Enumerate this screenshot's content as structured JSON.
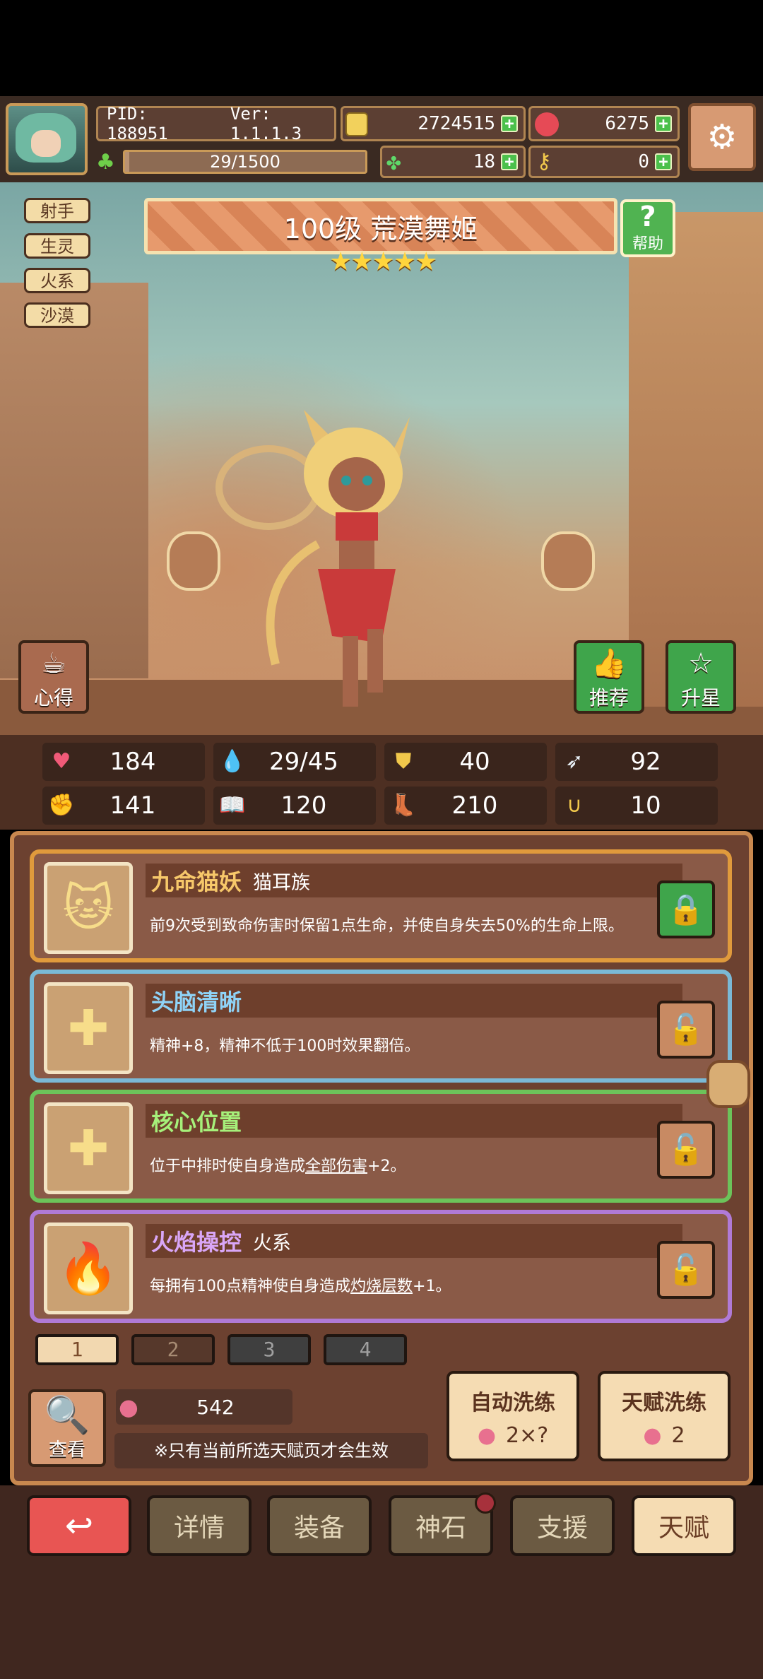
{
  "header": {
    "pid": "PID: 188951",
    "version": "Ver: 1.1.1.3",
    "exp": "29/1500",
    "exp_fraction": 0.019,
    "gold": "2724515",
    "gems": "6275",
    "clover": "18",
    "key": "0"
  },
  "tags": [
    "射手",
    "生灵",
    "火系",
    "沙漠"
  ],
  "hero": {
    "title": "100级  荒漠舞姬",
    "stars": "★★★★★",
    "star_count": 5
  },
  "buttons": {
    "help": "帮助",
    "notes": "心得",
    "recommend": "推荐",
    "star_up": "升星"
  },
  "stats": [
    "184",
    "29/45",
    "40",
    "92",
    "141",
    "120",
    "210",
    "10"
  ],
  "talents": [
    {
      "name": "九命猫妖",
      "sub": "猫耳族",
      "desc": "前9次受到致命伤害时保留1点生命，并使自身失去50%的生命上限。",
      "name_color": "#f7c86a",
      "border": "#e09a3c",
      "locked": true
    },
    {
      "name": "头脑清晰",
      "sub": "",
      "desc": "精神+8，精神不低于100时效果翻倍。",
      "name_color": "#8fd3f7",
      "border": "#7ab9d6",
      "locked": false
    },
    {
      "name": "核心位置",
      "sub": "",
      "desc_pre": "位于中排时使自身造成",
      "desc_u": "全部伤害",
      "desc_post": "+2。",
      "name_color": "#a6f07a",
      "border": "#6cc35a",
      "locked": false
    },
    {
      "name": "火焰操控",
      "sub": "火系",
      "desc_pre": "每拥有100点精神使自身造成",
      "desc_u": "灼烧层数",
      "desc_post": "+1。",
      "name_color": "#d9a6f7",
      "border": "#b07ad6",
      "locked": false
    }
  ],
  "pages": [
    "1",
    "2",
    "3",
    "4"
  ],
  "bottom": {
    "look": "查看",
    "fruit_count": "542",
    "note": "※只有当前所选天赋页才会生效",
    "auto_reroll": "自动洗练",
    "auto_cost": "2×?",
    "talent_reroll": "天赋洗练",
    "talent_cost": "2"
  },
  "nav": [
    "详情",
    "装备",
    "神石",
    "支援",
    "天赋"
  ]
}
